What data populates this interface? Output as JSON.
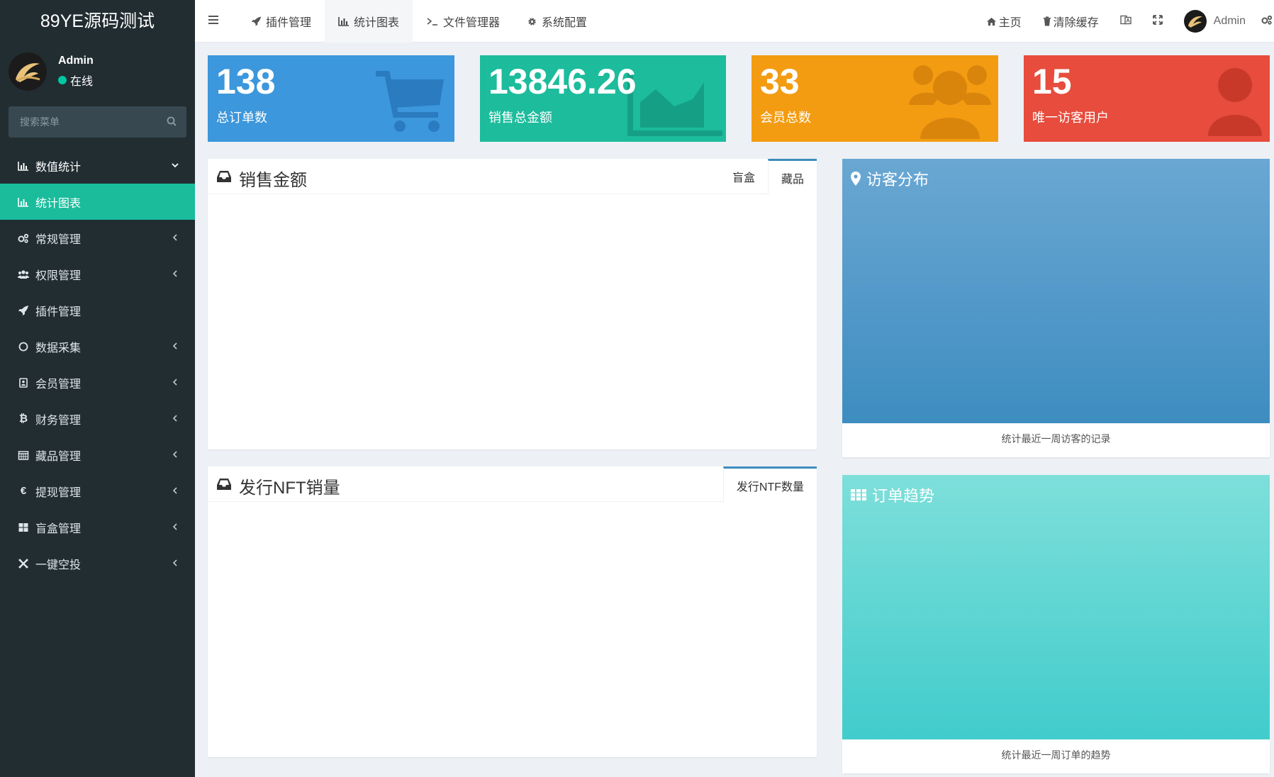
{
  "brand": {
    "title": "89YE源码测试"
  },
  "user": {
    "name": "Admin",
    "status": "在线"
  },
  "search": {
    "placeholder": "搜索菜单"
  },
  "sidebar": {
    "items": [
      {
        "label": "数值统计",
        "icon": "bar-chart-icon"
      },
      {
        "label": "统计图表",
        "icon": "bar-chart-icon"
      },
      {
        "label": "常规管理",
        "icon": "cogs-icon"
      },
      {
        "label": "权限管理",
        "icon": "users-icon"
      },
      {
        "label": "插件管理",
        "icon": "rocket-icon"
      },
      {
        "label": "数据采集",
        "icon": "circle-icon"
      },
      {
        "label": "会员管理",
        "icon": "id-card-icon"
      },
      {
        "label": "财务管理",
        "icon": "bitcoin-icon"
      },
      {
        "label": "藏品管理",
        "icon": "calendar-icon"
      },
      {
        "label": "提现管理",
        "icon": "euro-icon"
      },
      {
        "label": "盲盒管理",
        "icon": "grid-icon"
      },
      {
        "label": "一键空投",
        "icon": "joomla-icon"
      }
    ]
  },
  "topbar": {
    "tabs": [
      {
        "label": "插件管理",
        "icon": "rocket-icon"
      },
      {
        "label": "统计图表",
        "icon": "bar-chart-icon"
      },
      {
        "label": "文件管理器",
        "icon": "terminal-icon"
      },
      {
        "label": "系统配置",
        "icon": "gear-icon"
      }
    ],
    "home": "主页",
    "clear_cache": "清除缓存",
    "user": "Admin"
  },
  "stats": [
    {
      "value": "138",
      "label": "总订单数",
      "color": "#3c97dc"
    },
    {
      "value": "13846.26",
      "label": "销售总金额",
      "color": "#1cbc9c"
    },
    {
      "value": "33",
      "label": "会员总数",
      "color": "#f39c12"
    },
    {
      "value": "15",
      "label": "唯一访客用户",
      "color": "#e74c3c"
    }
  ],
  "sales_panel": {
    "title": "销售金额",
    "tabs": [
      "盲盒",
      "藏品"
    ]
  },
  "nft_panel": {
    "title": "发行NFT销量",
    "tabs": [
      "发行NTF数量"
    ]
  },
  "visitor_box": {
    "title": "访客分布",
    "footer": "统计最近一周访客的记录"
  },
  "order_box": {
    "title": "订单趋势",
    "footer": "统计最近一周订单的趋势"
  }
}
